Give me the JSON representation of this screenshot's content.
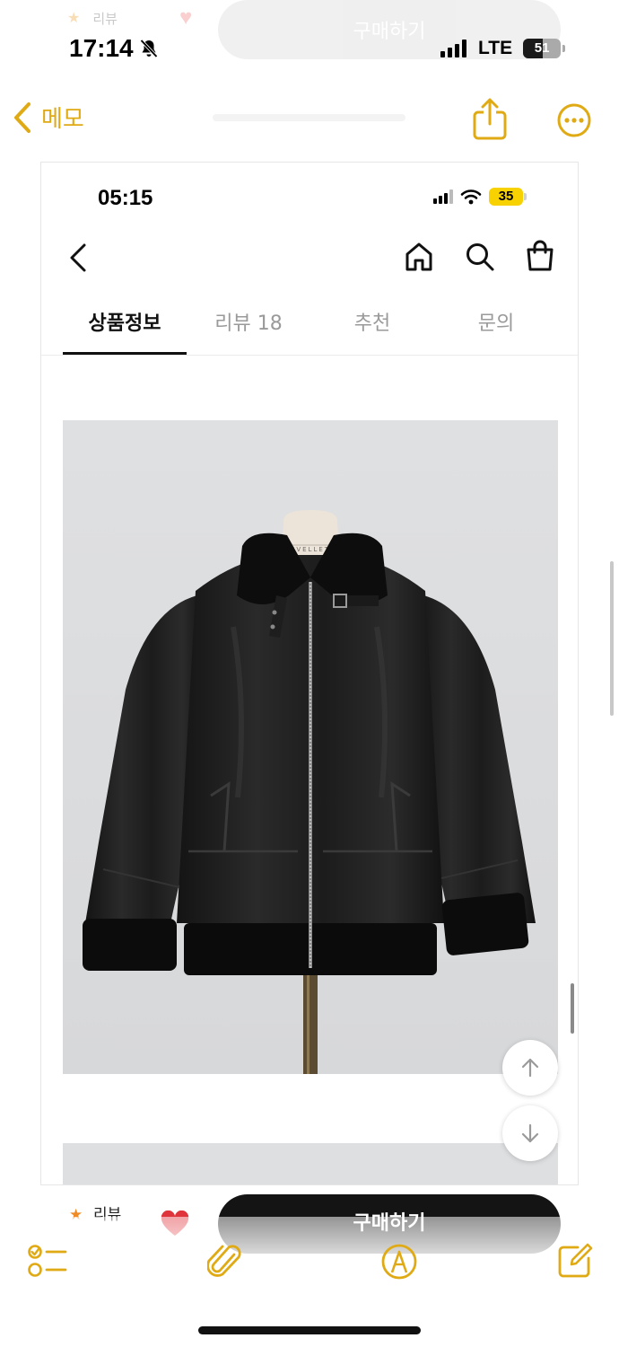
{
  "ghost_top": {
    "review_label": "리뷰",
    "buy_label": "구매하기"
  },
  "status_bar": {
    "time": "17:14",
    "network": "LTE",
    "battery": "51",
    "battery_level": 0.51
  },
  "notes_nav": {
    "back_label": "메모"
  },
  "inner_status": {
    "time": "05:15",
    "battery": "35"
  },
  "tabs": [
    {
      "label": "상품정보",
      "active": true
    },
    {
      "label": "리뷰 18",
      "active": false
    },
    {
      "label": "추천",
      "active": false
    },
    {
      "label": "문의",
      "active": false
    }
  ],
  "product": {
    "mannequin_brand": "EVELLET"
  },
  "bottom_bar": {
    "review_label": "리뷰",
    "buy_label": "구매하기"
  },
  "colors": {
    "accent": "#e0aa15",
    "buy_button": "#141414",
    "review_star": "#f08a24",
    "heart": "#e0343c",
    "inner_battery": "#f8d200"
  }
}
